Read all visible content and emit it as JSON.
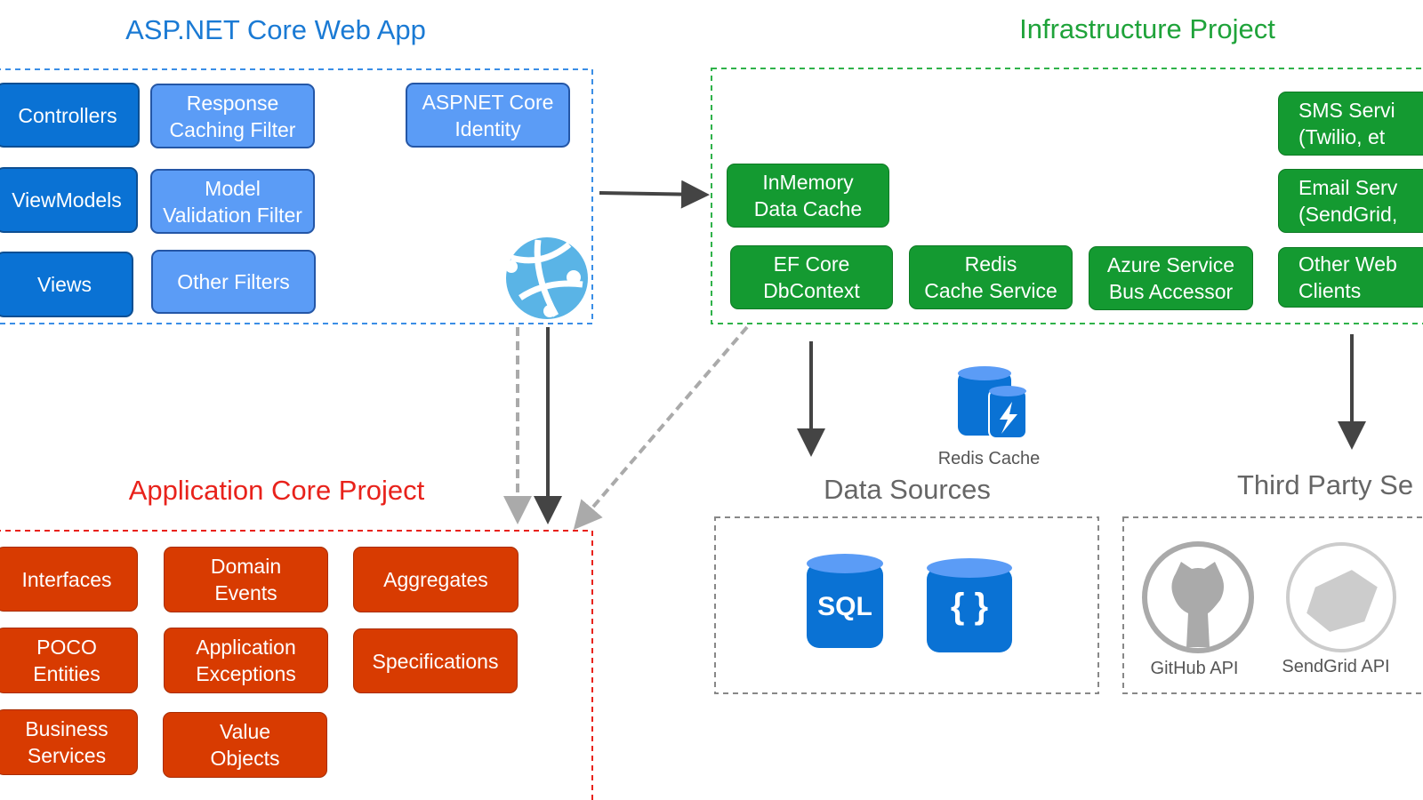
{
  "web_app": {
    "title": "ASP.NET Core Web App",
    "color": "#1a7ad4",
    "boxes": [
      [
        "Controllers"
      ],
      [
        "ViewModels"
      ],
      [
        "Views"
      ],
      [
        "Response",
        "Caching Filter"
      ],
      [
        "Model",
        "Validation Filter"
      ],
      [
        "Other Filters"
      ],
      [
        "ASPNET Core",
        "Identity"
      ]
    ]
  },
  "infrastructure": {
    "title": "Infrastructure Project",
    "color": "#1fa33a",
    "boxes": [
      [
        "InMemory",
        "Data Cache"
      ],
      [
        "EF Core",
        "DbContext"
      ],
      [
        "Redis",
        "Cache Service"
      ],
      [
        "Azure Service",
        "Bus Accessor"
      ],
      [
        "SMS Servi",
        "(Twilio, et"
      ],
      [
        "Email Serv",
        "(SendGrid,"
      ],
      [
        "Other Web",
        "Clients"
      ]
    ]
  },
  "app_core": {
    "title": "Application Core Project",
    "color": "#e8221b",
    "boxes": [
      [
        "Interfaces"
      ],
      [
        "POCO",
        "Entities"
      ],
      [
        "Business",
        "Services"
      ],
      [
        "Domain",
        "Events"
      ],
      [
        "Application",
        "Exceptions"
      ],
      [
        "Value",
        "Objects"
      ],
      [
        "Aggregates"
      ],
      [
        "Specifications"
      ]
    ]
  },
  "data_sources": {
    "title": "Data Sources",
    "redis_label": "Redis Cache",
    "sql_label": "SQL",
    "json_label": "{ }"
  },
  "third_party": {
    "title": "Third Party Se",
    "github_label": "GitHub API",
    "sendgrid_label": "SendGrid API"
  }
}
